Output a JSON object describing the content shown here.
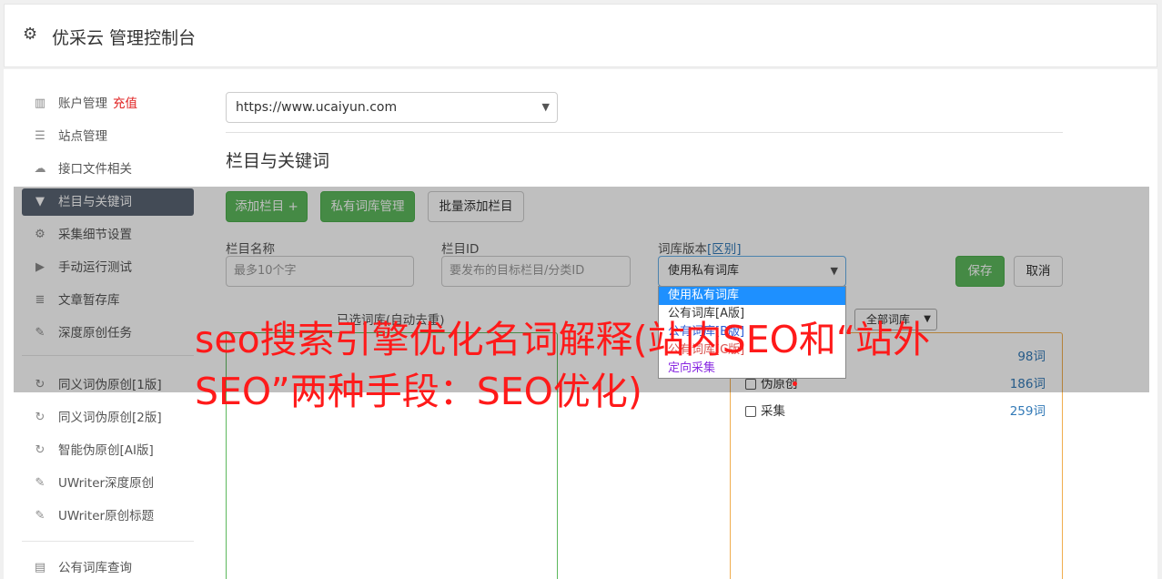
{
  "header": {
    "title": "优采云 管理控制台",
    "icon": "gear-icon"
  },
  "sidebar": {
    "items": [
      {
        "label": "账户管理",
        "badge": "充值",
        "icon": "bar-chart-icon"
      },
      {
        "label": "站点管理",
        "icon": "server-icon"
      },
      {
        "label": "接口文件相关",
        "icon": "cloud-upload-icon"
      },
      {
        "label": "栏目与关键词",
        "icon": "filter-icon",
        "active": true
      },
      {
        "label": "采集细节设置",
        "icon": "cogs-icon"
      },
      {
        "label": "手动运行测试",
        "icon": "play-icon"
      },
      {
        "label": "文章暂存库",
        "icon": "database-icon"
      },
      {
        "label": "深度原创任务",
        "icon": "edit-icon"
      },
      {
        "label": "同义词伪原创[1版]",
        "icon": "refresh-icon"
      },
      {
        "label": "同义词伪原创[2版]",
        "icon": "refresh-icon"
      },
      {
        "label": "智能伪原创[AI版]",
        "icon": "refresh-icon"
      },
      {
        "label": "UWriter深度原创",
        "icon": "edit-icon"
      },
      {
        "label": "UWriter原创标题",
        "icon": "edit-icon"
      },
      {
        "label": "公有词库查询",
        "icon": "book-icon"
      }
    ]
  },
  "site_select": {
    "value": "https://www.ucaiyun.com"
  },
  "section": {
    "title": "栏目与关键词"
  },
  "toolbar": {
    "add_column": "添加栏目 +",
    "private_lib": "私有词库管理",
    "batch_add": "批量添加栏目"
  },
  "form": {
    "name_label": "栏目名称",
    "name_placeholder": "最多10个字",
    "id_label": "栏目ID",
    "id_placeholder": "要发布的目标栏目/分类ID",
    "lib_label": "词库版本",
    "lib_link": "[区别]",
    "lib_value": "使用私有词库",
    "save": "保存",
    "cancel": "取消"
  },
  "lib_options": [
    "使用私有词库",
    "公有词库[A版]",
    "公有词库[B版]",
    "公有词库[C版]",
    "定向采集"
  ],
  "picked": {
    "label": "已选词库(自动去重)"
  },
  "filter_select": {
    "value": "全部词库"
  },
  "word_list": [
    {
      "name": "",
      "count": "98词"
    },
    {
      "name": "伪原创",
      "count": "186词"
    },
    {
      "name": "采集",
      "count": "259词"
    }
  ],
  "watermark": "seo搜索引擎优化名词解释(站内SEO和“站外SEO”两种手段：SEO优化)",
  "colors": {
    "green": "#5cb85c",
    "orange": "#f0ad4e",
    "sidebar_active": "#5a6473",
    "watermark": "#ff1a1a"
  }
}
